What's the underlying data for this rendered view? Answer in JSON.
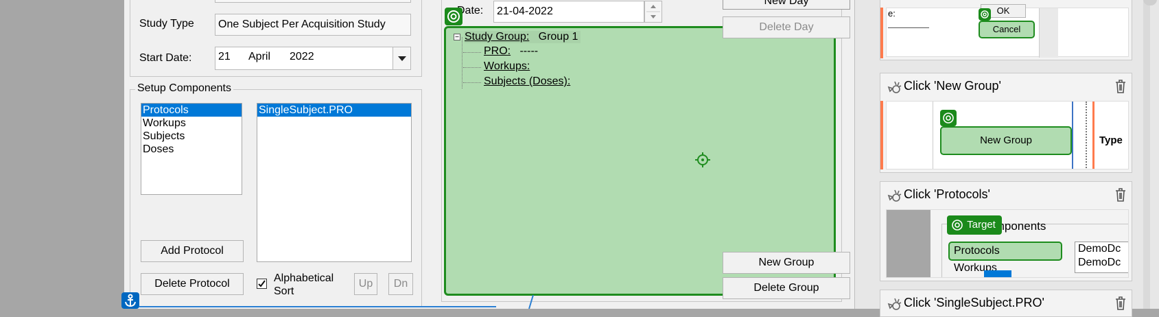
{
  "study_setup": {
    "study_type_label": "Study Type",
    "study_type_value": "One Subject Per Acquisition Study",
    "start_date_label": "Start Date:",
    "start_day": "21",
    "start_month": "April",
    "start_year": "2022",
    "setup_components_label": "Setup Components",
    "components": [
      "Protocols",
      "Workups",
      "Subjects",
      "Doses"
    ],
    "selected_component": "Protocols",
    "items": [
      "SingleSubject.PRO"
    ],
    "add_button": "Add Protocol",
    "delete_button": "Delete Protocol",
    "alphabetical_sort_line1": "Alphabetical",
    "alphabetical_sort_line2": "Sort",
    "alphabetical_sort_checked": true,
    "up_button": "Up",
    "down_button": "Dn"
  },
  "schedule": {
    "date_label": "Date:",
    "date_value": "21-04-2022",
    "tree": {
      "group_label": "Study Group:",
      "group_value": "Group 1",
      "pro_label": "PRO:",
      "pro_value": "-----",
      "workups_label": "Workups:",
      "subjects_label": "Subjects (Doses):"
    }
  },
  "day_group_buttons": {
    "new_day": "New Day",
    "delete_day": "Delete Day",
    "new_group": "New Group",
    "delete_group": "Delete Group"
  },
  "recorder_panel": {
    "steps": [
      {
        "title": "Click 'New Group'",
        "preview_button": "New Group",
        "preview_side_label": "Type"
      },
      {
        "title": "Click 'Protocols'",
        "preview_badge": "Target",
        "preview_heading": "Components",
        "preview_item1": "Protocols",
        "preview_item2": "Workups",
        "preview_right1": "DemoDc",
        "preview_right2": "DemoDc"
      },
      {
        "title": "Click 'SingleSubject.PRO'"
      }
    ],
    "top_preview": {
      "ok": "OK",
      "cancel": "Cancel",
      "field_label": "e:"
    }
  },
  "colors": {
    "highlight_green": "#b1dcb1",
    "highlight_border": "#1e8c1e",
    "selection_blue": "#0078d7",
    "step_orange": "#ff7b4d"
  }
}
